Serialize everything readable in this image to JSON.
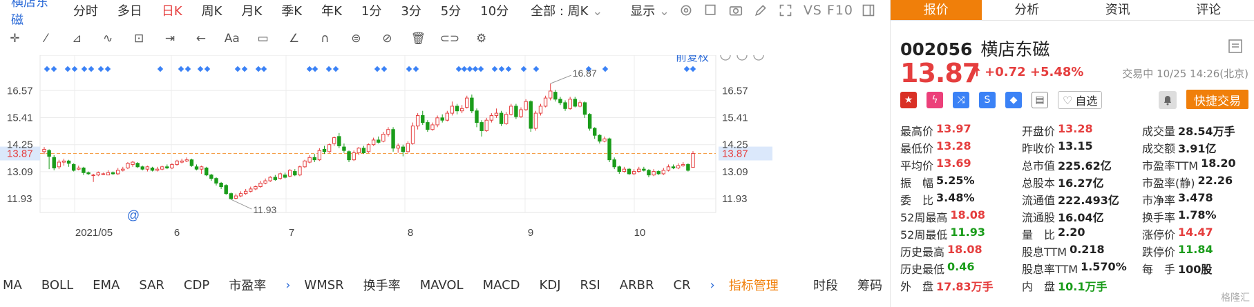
{
  "toolbar": {
    "stock_name": "横店东磁",
    "periods": [
      "分时",
      "多日",
      "日K",
      "周K",
      "月K",
      "季K",
      "年K",
      "1分",
      "3分",
      "5分",
      "10分"
    ],
    "active_period": "日K",
    "range_select": "全部 : 周K",
    "display_label": "显示",
    "vs_label": "VS F10"
  },
  "chart": {
    "adjust_label": "前复权",
    "last_price_label": "13.87",
    "high_annotation": "16.87",
    "low_annotation": "11.93",
    "left_ticks": [
      "16.57",
      "15.41",
      "14.25",
      "13.87",
      "13.09",
      "11.93"
    ],
    "right_ticks": [
      "16.57",
      "15.41",
      "14.25",
      "13.87",
      "13.09",
      "11.93"
    ],
    "x_labels": [
      "2021/05",
      "6",
      "7",
      "8",
      "9",
      "10"
    ],
    "at_marker": "@"
  },
  "chart_data": {
    "type": "candlestick",
    "title": "",
    "ylim": [
      11.4,
      17.2
    ],
    "y_ticks": [
      11.93,
      13.09,
      14.25,
      15.41,
      16.57
    ],
    "last_price": 13.87,
    "high": 16.87,
    "low": 11.93,
    "x_ticks": [
      "2021/05",
      "6",
      "7",
      "8",
      "9",
      "10"
    ],
    "candles": [
      {
        "o": 13.95,
        "c": 14.05,
        "h": 14.15,
        "l": 13.85
      },
      {
        "o": 14.0,
        "c": 13.75,
        "h": 14.05,
        "l": 13.2
      },
      {
        "o": 13.7,
        "c": 13.25,
        "h": 13.8,
        "l": 13.15
      },
      {
        "o": 13.3,
        "c": 13.5,
        "h": 13.6,
        "l": 13.2
      },
      {
        "o": 13.5,
        "c": 13.55,
        "h": 13.65,
        "l": 13.35
      },
      {
        "o": 13.55,
        "c": 13.45,
        "h": 13.6,
        "l": 13.3
      },
      {
        "o": 13.4,
        "c": 13.15,
        "h": 13.45,
        "l": 13.1
      },
      {
        "o": 13.2,
        "c": 13.25,
        "h": 13.35,
        "l": 13.15
      },
      {
        "o": 13.25,
        "c": 13.05,
        "h": 13.3,
        "l": 12.95
      },
      {
        "o": 13.05,
        "c": 13.0,
        "h": 13.1,
        "l": 12.95
      },
      {
        "o": 12.95,
        "c": 12.95,
        "h": 13.0,
        "l": 12.65
      },
      {
        "o": 12.95,
        "c": 13.05,
        "h": 13.1,
        "l": 12.9
      },
      {
        "o": 13.0,
        "c": 13.0,
        "h": 13.05,
        "l": 12.95
      },
      {
        "o": 12.95,
        "c": 13.05,
        "h": 13.15,
        "l": 12.95
      },
      {
        "o": 13.05,
        "c": 13.0,
        "h": 13.1,
        "l": 12.95
      },
      {
        "o": 13.0,
        "c": 13.15,
        "h": 13.25,
        "l": 12.95
      },
      {
        "o": 13.15,
        "c": 13.2,
        "h": 13.3,
        "l": 13.1
      },
      {
        "o": 13.25,
        "c": 13.45,
        "h": 13.5,
        "l": 13.2
      },
      {
        "o": 13.4,
        "c": 13.5,
        "h": 13.55,
        "l": 13.3
      },
      {
        "o": 13.45,
        "c": 13.3,
        "h": 13.5,
        "l": 13.25
      },
      {
        "o": 13.3,
        "c": 13.2,
        "h": 13.35,
        "l": 13.15
      },
      {
        "o": 13.2,
        "c": 13.3,
        "h": 13.35,
        "l": 13.1
      },
      {
        "o": 13.25,
        "c": 13.15,
        "h": 13.3,
        "l": 13.1
      },
      {
        "o": 13.15,
        "c": 13.2,
        "h": 13.3,
        "l": 13.1
      },
      {
        "o": 13.2,
        "c": 13.3,
        "h": 13.35,
        "l": 13.15
      },
      {
        "o": 13.3,
        "c": 13.25,
        "h": 13.4,
        "l": 13.2
      },
      {
        "o": 13.25,
        "c": 13.4,
        "h": 13.45,
        "l": 13.2
      },
      {
        "o": 13.4,
        "c": 13.55,
        "h": 13.6,
        "l": 13.35
      },
      {
        "o": 13.5,
        "c": 13.55,
        "h": 13.65,
        "l": 13.45
      },
      {
        "o": 13.55,
        "c": 13.6,
        "h": 13.7,
        "l": 13.5
      },
      {
        "o": 13.6,
        "c": 13.35,
        "h": 13.65,
        "l": 13.3
      },
      {
        "o": 13.3,
        "c": 13.2,
        "h": 13.4,
        "l": 13.15
      },
      {
        "o": 13.2,
        "c": 13.3,
        "h": 13.35,
        "l": 13.0
      },
      {
        "o": 13.25,
        "c": 12.95,
        "h": 13.3,
        "l": 12.9
      },
      {
        "o": 12.95,
        "c": 12.8,
        "h": 13.0,
        "l": 12.7
      },
      {
        "o": 12.8,
        "c": 12.6,
        "h": 12.85,
        "l": 12.5
      },
      {
        "o": 12.6,
        "c": 12.45,
        "h": 12.65,
        "l": 12.35
      },
      {
        "o": 12.5,
        "c": 12.15,
        "h": 12.55,
        "l": 12.1
      },
      {
        "o": 12.15,
        "c": 11.93,
        "h": 12.2,
        "l": 11.9
      },
      {
        "o": 11.95,
        "c": 12.05,
        "h": 12.15,
        "l": 11.9
      },
      {
        "o": 12.05,
        "c": 12.15,
        "h": 12.25,
        "l": 12.0
      },
      {
        "o": 12.15,
        "c": 12.25,
        "h": 12.35,
        "l": 12.1
      },
      {
        "o": 12.25,
        "c": 12.35,
        "h": 12.45,
        "l": 12.2
      },
      {
        "o": 12.35,
        "c": 12.45,
        "h": 12.5,
        "l": 12.3
      },
      {
        "o": 12.45,
        "c": 12.6,
        "h": 12.7,
        "l": 12.4
      },
      {
        "o": 12.6,
        "c": 12.7,
        "h": 12.8,
        "l": 12.55
      },
      {
        "o": 12.7,
        "c": 12.85,
        "h": 12.9,
        "l": 12.65
      },
      {
        "o": 12.85,
        "c": 12.75,
        "h": 12.95,
        "l": 12.7
      },
      {
        "o": 12.8,
        "c": 13.0,
        "h": 13.05,
        "l": 12.75
      },
      {
        "o": 12.95,
        "c": 12.85,
        "h": 13.05,
        "l": 12.8
      },
      {
        "o": 12.9,
        "c": 13.15,
        "h": 13.2,
        "l": 12.85
      },
      {
        "o": 13.1,
        "c": 12.95,
        "h": 13.2,
        "l": 12.9
      },
      {
        "o": 12.95,
        "c": 13.3,
        "h": 13.35,
        "l": 12.9
      },
      {
        "o": 13.3,
        "c": 13.55,
        "h": 13.6,
        "l": 13.25
      },
      {
        "o": 13.5,
        "c": 13.7,
        "h": 13.8,
        "l": 13.45
      },
      {
        "o": 13.7,
        "c": 13.6,
        "h": 13.85,
        "l": 13.5
      },
      {
        "o": 13.6,
        "c": 14.0,
        "h": 14.1,
        "l": 13.55
      },
      {
        "o": 14.05,
        "c": 13.95,
        "h": 14.2,
        "l": 13.85
      },
      {
        "o": 13.95,
        "c": 14.25,
        "h": 14.3,
        "l": 13.9
      },
      {
        "o": 14.3,
        "c": 14.55,
        "h": 14.6,
        "l": 14.2
      },
      {
        "o": 14.6,
        "c": 14.2,
        "h": 14.75,
        "l": 14.1
      },
      {
        "o": 14.15,
        "c": 14.0,
        "h": 14.3,
        "l": 13.9
      },
      {
        "o": 13.95,
        "c": 13.6,
        "h": 14.0,
        "l": 13.5
      },
      {
        "o": 13.6,
        "c": 13.9,
        "h": 14.0,
        "l": 13.55
      },
      {
        "o": 13.9,
        "c": 14.1,
        "h": 14.15,
        "l": 13.8
      },
      {
        "o": 14.1,
        "c": 13.9,
        "h": 14.2,
        "l": 13.85
      },
      {
        "o": 13.95,
        "c": 14.25,
        "h": 14.3,
        "l": 13.9
      },
      {
        "o": 14.25,
        "c": 14.45,
        "h": 14.55,
        "l": 14.2
      },
      {
        "o": 14.45,
        "c": 14.35,
        "h": 14.6,
        "l": 14.3
      },
      {
        "o": 14.4,
        "c": 14.7,
        "h": 14.8,
        "l": 14.35
      },
      {
        "o": 14.7,
        "c": 14.9,
        "h": 15.0,
        "l": 14.6
      },
      {
        "o": 14.9,
        "c": 14.1,
        "h": 15.0,
        "l": 13.95
      },
      {
        "o": 14.1,
        "c": 14.2,
        "h": 14.3,
        "l": 13.9
      },
      {
        "o": 14.15,
        "c": 13.95,
        "h": 14.25,
        "l": 13.75
      },
      {
        "o": 13.95,
        "c": 14.3,
        "h": 14.4,
        "l": 13.9
      },
      {
        "o": 14.3,
        "c": 15.05,
        "h": 15.2,
        "l": 14.25
      },
      {
        "o": 15.05,
        "c": 15.5,
        "h": 15.6,
        "l": 14.9
      },
      {
        "o": 15.5,
        "c": 15.2,
        "h": 15.7,
        "l": 15.1
      },
      {
        "o": 15.2,
        "c": 14.9,
        "h": 15.3,
        "l": 14.8
      },
      {
        "o": 14.9,
        "c": 15.1,
        "h": 15.2,
        "l": 14.85
      },
      {
        "o": 15.1,
        "c": 15.4,
        "h": 15.5,
        "l": 15.0
      },
      {
        "o": 15.4,
        "c": 15.3,
        "h": 15.55,
        "l": 15.2
      },
      {
        "o": 15.3,
        "c": 15.6,
        "h": 15.7,
        "l": 15.25
      },
      {
        "o": 15.6,
        "c": 15.9,
        "h": 16.1,
        "l": 15.5
      },
      {
        "o": 15.9,
        "c": 15.7,
        "h": 16.0,
        "l": 15.55
      },
      {
        "o": 15.7,
        "c": 15.8,
        "h": 15.95,
        "l": 15.6
      },
      {
        "o": 15.85,
        "c": 16.25,
        "h": 16.35,
        "l": 15.8
      },
      {
        "o": 16.25,
        "c": 15.7,
        "h": 16.4,
        "l": 15.6
      },
      {
        "o": 15.7,
        "c": 15.2,
        "h": 15.8,
        "l": 15.0
      },
      {
        "o": 15.2,
        "c": 14.85,
        "h": 15.3,
        "l": 14.6
      },
      {
        "o": 14.85,
        "c": 15.3,
        "h": 15.4,
        "l": 14.8
      },
      {
        "o": 15.3,
        "c": 15.5,
        "h": 15.6,
        "l": 15.2
      },
      {
        "o": 15.5,
        "c": 15.6,
        "h": 15.8,
        "l": 15.4
      },
      {
        "o": 15.6,
        "c": 15.15,
        "h": 15.7,
        "l": 15.05
      },
      {
        "o": 15.15,
        "c": 15.55,
        "h": 15.65,
        "l": 15.1
      },
      {
        "o": 15.55,
        "c": 15.9,
        "h": 16.0,
        "l": 15.5
      },
      {
        "o": 15.9,
        "c": 15.45,
        "h": 16.0,
        "l": 15.35
      },
      {
        "o": 15.45,
        "c": 15.75,
        "h": 15.85,
        "l": 15.4
      },
      {
        "o": 15.75,
        "c": 16.1,
        "h": 16.2,
        "l": 15.7
      },
      {
        "o": 16.1,
        "c": 14.95,
        "h": 16.15,
        "l": 14.8
      },
      {
        "o": 14.95,
        "c": 15.6,
        "h": 15.7,
        "l": 14.85
      },
      {
        "o": 15.6,
        "c": 15.9,
        "h": 16.0,
        "l": 15.5
      },
      {
        "o": 15.9,
        "c": 16.25,
        "h": 16.35,
        "l": 15.85
      },
      {
        "o": 16.25,
        "c": 16.55,
        "h": 16.87,
        "l": 16.15
      },
      {
        "o": 16.5,
        "c": 16.2,
        "h": 16.6,
        "l": 16.1
      },
      {
        "o": 16.2,
        "c": 16.05,
        "h": 16.3,
        "l": 15.95
      },
      {
        "o": 16.05,
        "c": 15.8,
        "h": 16.15,
        "l": 15.7
      },
      {
        "o": 15.8,
        "c": 16.2,
        "h": 16.3,
        "l": 15.75
      },
      {
        "o": 16.2,
        "c": 15.9,
        "h": 16.3,
        "l": 15.85
      },
      {
        "o": 15.9,
        "c": 16.05,
        "h": 16.15,
        "l": 15.85
      },
      {
        "o": 16.05,
        "c": 15.55,
        "h": 16.1,
        "l": 15.4
      },
      {
        "o": 15.55,
        "c": 14.95,
        "h": 15.6,
        "l": 14.85
      },
      {
        "o": 14.95,
        "c": 14.65,
        "h": 15.0,
        "l": 14.5
      },
      {
        "o": 14.65,
        "c": 14.4,
        "h": 14.7,
        "l": 14.3
      },
      {
        "o": 14.4,
        "c": 14.5,
        "h": 14.6,
        "l": 14.35
      },
      {
        "o": 14.5,
        "c": 13.6,
        "h": 14.55,
        "l": 13.5
      },
      {
        "o": 13.6,
        "c": 13.3,
        "h": 13.7,
        "l": 13.2
      },
      {
        "o": 13.3,
        "c": 13.1,
        "h": 13.35,
        "l": 13.0
      },
      {
        "o": 13.1,
        "c": 13.2,
        "h": 13.3,
        "l": 13.05
      },
      {
        "o": 13.2,
        "c": 13.0,
        "h": 13.25,
        "l": 12.95
      },
      {
        "o": 13.0,
        "c": 13.1,
        "h": 13.2,
        "l": 12.95
      },
      {
        "o": 13.1,
        "c": 13.2,
        "h": 13.3,
        "l": 13.05
      },
      {
        "o": 13.2,
        "c": 13.15,
        "h": 13.3,
        "l": 13.1
      },
      {
        "o": 13.15,
        "c": 12.95,
        "h": 13.2,
        "l": 12.85
      },
      {
        "o": 12.95,
        "c": 13.1,
        "h": 13.2,
        "l": 12.9
      },
      {
        "o": 13.1,
        "c": 13.0,
        "h": 13.15,
        "l": 12.95
      },
      {
        "o": 13.0,
        "c": 13.15,
        "h": 13.25,
        "l": 12.95
      },
      {
        "o": 13.15,
        "c": 13.3,
        "h": 13.4,
        "l": 13.1
      },
      {
        "o": 13.3,
        "c": 13.25,
        "h": 13.4,
        "l": 13.2
      },
      {
        "o": 13.25,
        "c": 13.35,
        "h": 13.45,
        "l": 13.2
      },
      {
        "o": 13.35,
        "c": 13.4,
        "h": 13.5,
        "l": 13.3
      },
      {
        "o": 13.4,
        "c": 13.15,
        "h": 13.45,
        "l": 13.1
      },
      {
        "o": 13.28,
        "c": 13.87,
        "h": 13.97,
        "l": 13.28
      }
    ]
  },
  "toolbar2_icons": [
    "crosshair-icon",
    "line-icon",
    "polyline-icon",
    "wave-icon",
    "measure-icon",
    "range-icon",
    "back-icon",
    "text-icon",
    "comment-icon",
    "angle-icon",
    "magnet-icon",
    "eye-icon",
    "hide-icon",
    "trash-icon",
    "link-icon",
    "settings-icon"
  ],
  "indicators": {
    "left": [
      "MA",
      "BOLL",
      "EMA",
      "SAR",
      "CDP",
      "市盈率"
    ],
    "right": [
      "WMSR",
      "换手率",
      "MAVOL",
      "MACD",
      "KDJ",
      "RSI",
      "ARBR",
      "CR"
    ],
    "manage": "指标管理",
    "extra": [
      "时段",
      "筹码"
    ]
  },
  "tabs": [
    "报价",
    "分析",
    "资讯",
    "评论"
  ],
  "active_tab": "报价",
  "quote": {
    "code": "002056",
    "name": "横店东磁",
    "price": "13.87",
    "change": "+0.72",
    "change_pct": "+5.48%",
    "status": "交易中 10/25 14:26(北京)",
    "self_select": "自选",
    "quick_trade": "快捷交易"
  },
  "stats": [
    [
      {
        "label": "最高价",
        "value": "13.97",
        "color": "red"
      },
      {
        "label": "开盘价",
        "value": "13.28",
        "color": "red"
      },
      {
        "label": "成交量",
        "value": "28.54万手",
        "color": ""
      }
    ],
    [
      {
        "label": "最低价",
        "value": "13.28",
        "color": "red"
      },
      {
        "label": "昨收价",
        "value": "13.15",
        "color": ""
      },
      {
        "label": "成交额",
        "value": "3.91亿",
        "color": ""
      }
    ],
    [
      {
        "label": "平均价",
        "value": "13.69",
        "color": "red"
      },
      {
        "label": "总市值",
        "value": "225.62亿",
        "color": ""
      },
      {
        "label": "市盈率TTM",
        "value": "18.20",
        "color": ""
      }
    ],
    [
      {
        "label": "振　幅",
        "value": "5.25%",
        "color": ""
      },
      {
        "label": "总股本",
        "value": "16.27亿",
        "color": ""
      },
      {
        "label": "市盈率(静)",
        "value": "22.26",
        "color": ""
      }
    ],
    [
      {
        "label": "委　比",
        "value": "3.48%",
        "color": ""
      },
      {
        "label": "流通值",
        "value": "222.493亿",
        "color": ""
      },
      {
        "label": "市净率",
        "value": "3.478",
        "color": ""
      }
    ],
    [
      {
        "label": "52周最高",
        "value": "18.08",
        "color": "red"
      },
      {
        "label": "流通股",
        "value": "16.04亿",
        "color": ""
      },
      {
        "label": "换手率",
        "value": "1.78%",
        "color": ""
      }
    ],
    [
      {
        "label": "52周最低",
        "value": "11.93",
        "color": "green"
      },
      {
        "label": "量　比",
        "value": "2.20",
        "color": ""
      },
      {
        "label": "涨停价",
        "value": "14.47",
        "color": "red"
      }
    ],
    [
      {
        "label": "历史最高",
        "value": "18.08",
        "color": "red"
      },
      {
        "label": "股息TTM",
        "value": "0.218",
        "color": ""
      },
      {
        "label": "跌停价",
        "value": "11.84",
        "color": "green"
      }
    ],
    [
      {
        "label": "历史最低",
        "value": "0.46",
        "color": "green"
      },
      {
        "label": "股息率TTM",
        "value": "1.570%",
        "color": ""
      },
      {
        "label": "每　手",
        "value": "100股",
        "color": ""
      }
    ],
    [
      {
        "label": "外　盘",
        "value": "17.83万手",
        "color": "red"
      },
      {
        "label": "内　盘",
        "value": "10.1万手",
        "color": "green"
      },
      {
        "label": "",
        "value": "",
        "color": ""
      }
    ]
  ],
  "watermark": "格隆汇"
}
